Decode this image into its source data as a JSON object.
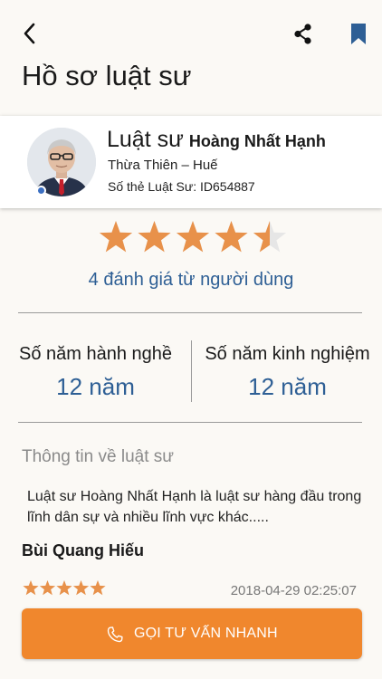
{
  "header": {
    "title": "Hồ sơ luật sư",
    "icons": {
      "back": "arrow-left",
      "share": "share-nodes",
      "bookmark": "bookmark"
    }
  },
  "profile": {
    "prefix": "Luật sư",
    "name": "Hoàng Nhất Hạnh",
    "location": "Thừa Thiên – Huế",
    "card_id": "Số thẻ Luật Sư: ID654887",
    "status_color": "#3b6fc2"
  },
  "rating": {
    "value": 4.5,
    "max": 5,
    "count_text": "4 đánh giá từ người dùng",
    "star_color": "#e8914a",
    "empty_star_color": "#e6e6e6"
  },
  "stats": {
    "practice_label": "Số năm hành nghề",
    "practice_value": "12 năm",
    "experience_label": "Số năm kinh nghiệm",
    "experience_value": "12 năm"
  },
  "about": {
    "title": "Thông tin về luật sư",
    "text": "Luật sư Hoàng Nhất Hạnh là luật sư hàng đầu trong lĩnh dân sự và nhiều lĩnh vực khác....."
  },
  "review": {
    "reviewer": "Bùi Quang Hiếu",
    "stars": 5,
    "date": "2018-04-29 02:25:07"
  },
  "cta": {
    "label": "GỌI TƯ VẤN NHANH",
    "color": "#f0872d",
    "icon": "phone"
  }
}
